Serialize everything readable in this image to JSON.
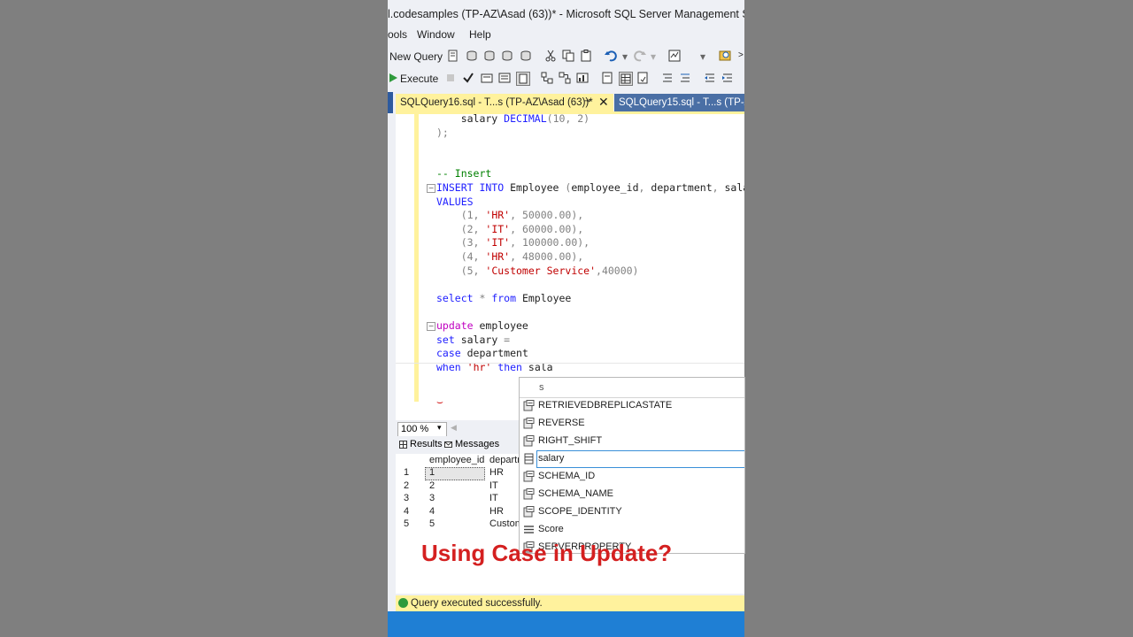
{
  "window": {
    "title": "l.codesamples (TP-AZ\\Asad (63))* - Microsoft SQL Server Management Studio"
  },
  "menu": {
    "items": [
      "ools",
      "Window",
      "Help"
    ]
  },
  "toolbar1": {
    "new_query_label": "New Query"
  },
  "toolbar2": {
    "execute_label": "Execute"
  },
  "tabs": {
    "active": "SQLQuery16.sql - T...s (TP-AZ\\Asad (63))*",
    "inactive": "SQLQuery15.sql - T...s (TP-AZ"
  },
  "editor": {
    "lines": [
      {
        "parts": [
          {
            "t": "    salary ",
            "c": ""
          },
          {
            "t": "DECIMAL",
            "c": "kw"
          },
          {
            "t": "(10, 2)",
            "c": "op"
          }
        ]
      },
      {
        "parts": [
          {
            "t": ");",
            "c": "op"
          }
        ]
      },
      {
        "parts": []
      },
      {
        "parts": []
      },
      {
        "parts": [
          {
            "t": "-- Insert",
            "c": "cmt"
          }
        ]
      },
      {
        "parts": [
          {
            "t": "INSERT INTO",
            "c": "kw"
          },
          {
            "t": " Employee ",
            "c": ""
          },
          {
            "t": "(",
            "c": "op"
          },
          {
            "t": "employee_id",
            "c": ""
          },
          {
            "t": ", ",
            "c": "op"
          },
          {
            "t": "department",
            "c": ""
          },
          {
            "t": ", ",
            "c": "op"
          },
          {
            "t": "salary",
            "c": ""
          },
          {
            "t": ")",
            "c": "op"
          }
        ]
      },
      {
        "parts": [
          {
            "t": "VALUES",
            "c": "kw"
          }
        ]
      },
      {
        "parts": [
          {
            "t": "    (1, ",
            "c": "op"
          },
          {
            "t": "'HR'",
            "c": "str"
          },
          {
            "t": ", 50000.00),",
            "c": "op"
          }
        ]
      },
      {
        "parts": [
          {
            "t": "    (2, ",
            "c": "op"
          },
          {
            "t": "'IT'",
            "c": "str"
          },
          {
            "t": ", 60000.00),",
            "c": "op"
          }
        ]
      },
      {
        "parts": [
          {
            "t": "    (3, ",
            "c": "op"
          },
          {
            "t": "'IT'",
            "c": "str"
          },
          {
            "t": ", 100000.00),",
            "c": "op"
          }
        ]
      },
      {
        "parts": [
          {
            "t": "    (4, ",
            "c": "op"
          },
          {
            "t": "'HR'",
            "c": "str"
          },
          {
            "t": ", 48000.00),",
            "c": "op"
          }
        ]
      },
      {
        "parts": [
          {
            "t": "    (5, ",
            "c": "op"
          },
          {
            "t": "'Customer Service'",
            "c": "str"
          },
          {
            "t": ",40000)",
            "c": "op"
          }
        ]
      },
      {
        "parts": []
      },
      {
        "parts": [
          {
            "t": "select",
            "c": "kw"
          },
          {
            "t": " * ",
            "c": "op"
          },
          {
            "t": "from",
            "c": "kw"
          },
          {
            "t": " Employee",
            "c": ""
          }
        ]
      },
      {
        "parts": []
      },
      {
        "parts": [
          {
            "t": "update",
            "c": "fn"
          },
          {
            "t": " employee",
            "c": ""
          }
        ]
      },
      {
        "parts": [
          {
            "t": "set",
            "c": "kw"
          },
          {
            "t": " salary ",
            "c": ""
          },
          {
            "t": "=",
            "c": "op"
          }
        ]
      },
      {
        "parts": [
          {
            "t": "case",
            "c": "kw"
          },
          {
            "t": " department",
            "c": ""
          }
        ]
      },
      {
        "parts": [
          {
            "t": "when",
            "c": "kw"
          },
          {
            "t": " ",
            "c": ""
          },
          {
            "t": "'hr'",
            "c": "str"
          },
          {
            "t": " ",
            "c": ""
          },
          {
            "t": "then",
            "c": "kw"
          },
          {
            "t": " sala",
            "c": ""
          }
        ]
      }
    ]
  },
  "autocomplete": {
    "filter": "s",
    "items": [
      {
        "label": "RETRIEVEDBREPLICASTATE",
        "icon": "function-icon"
      },
      {
        "label": "REVERSE",
        "icon": "function-icon"
      },
      {
        "label": "RIGHT_SHIFT",
        "icon": "function-icon"
      },
      {
        "label": "salary",
        "icon": "column-icon",
        "selected": true
      },
      {
        "label": "SCHEMA_ID",
        "icon": "function-icon"
      },
      {
        "label": "SCHEMA_NAME",
        "icon": "function-icon"
      },
      {
        "label": "SCOPE_IDENTITY",
        "icon": "function-icon"
      },
      {
        "label": "Score",
        "icon": "table-icon"
      },
      {
        "label": "SERVERPROPERTY",
        "icon": "function-icon"
      }
    ]
  },
  "zoom": {
    "value": "100 %"
  },
  "results": {
    "tabs": [
      "Results",
      "Messages"
    ],
    "columns": [
      "employee_id",
      "departm"
    ],
    "rows": [
      {
        "n": "1",
        "id": "1",
        "dept": "HR"
      },
      {
        "n": "2",
        "id": "2",
        "dept": "IT"
      },
      {
        "n": "3",
        "id": "3",
        "dept": "IT"
      },
      {
        "n": "4",
        "id": "4",
        "dept": "HR"
      },
      {
        "n": "5",
        "id": "5",
        "dept": "Custom"
      }
    ]
  },
  "status": {
    "message": "Query executed successfully."
  },
  "caption": {
    "text": "Using Case in Update?"
  }
}
